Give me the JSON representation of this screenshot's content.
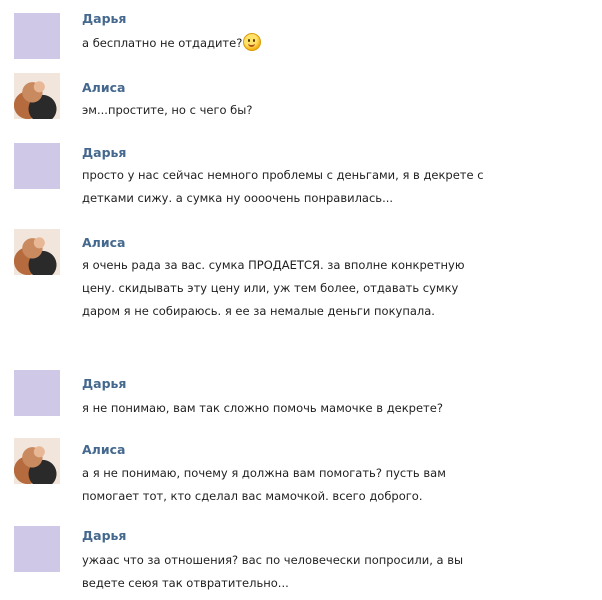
{
  "messages": [
    {
      "author": "Дарья",
      "avatar": "lilac-placeholder",
      "lines": [
        "а бесплатно не отдадите?"
      ],
      "emoji": "smiling-face"
    },
    {
      "author": "Алиса",
      "avatar": "user-photo",
      "lines": [
        "эм...простите, но с чего бы?"
      ]
    },
    {
      "author": "Дарья",
      "avatar": "lilac-placeholder",
      "lines": [
        "просто у нас сейчас немного проблемы с деньгами, я в декрете с",
        "детками сижу. а сумка ну оооочень понравилась..."
      ]
    },
    {
      "author": "Алиса",
      "avatar": "user-photo",
      "lines": [
        "я очень рада за вас. сумка ПРОДАЕТСЯ. за вполне конкретную",
        "цену. скидывать эту цену или, уж тем более, отдавать сумку",
        "даром я не собираюсь. я ее за немалые деньги покупала."
      ]
    },
    {
      "author": "Дарья",
      "avatar": "lilac-placeholder",
      "lines": [
        "я не понимаю, вам так сложно помочь мамочке в декрете?"
      ]
    },
    {
      "author": "Алиса",
      "avatar": "user-photo",
      "lines": [
        "а я не понимаю, почему я должна вам помогать? пусть вам",
        "помогает тот, кто сделал вас мамочкой. всего доброго."
      ]
    },
    {
      "author": "Дарья",
      "avatar": "lilac-placeholder",
      "lines": [
        "ужаас что за отношения? вас по человечески попросили, а вы",
        "ведете сеюя так отвратительно..."
      ]
    }
  ],
  "colors": {
    "author_link": "#45688e",
    "placeholder_avatar": "#cfc8e6",
    "text": "#1f1f1f",
    "background": "#ffffff"
  }
}
